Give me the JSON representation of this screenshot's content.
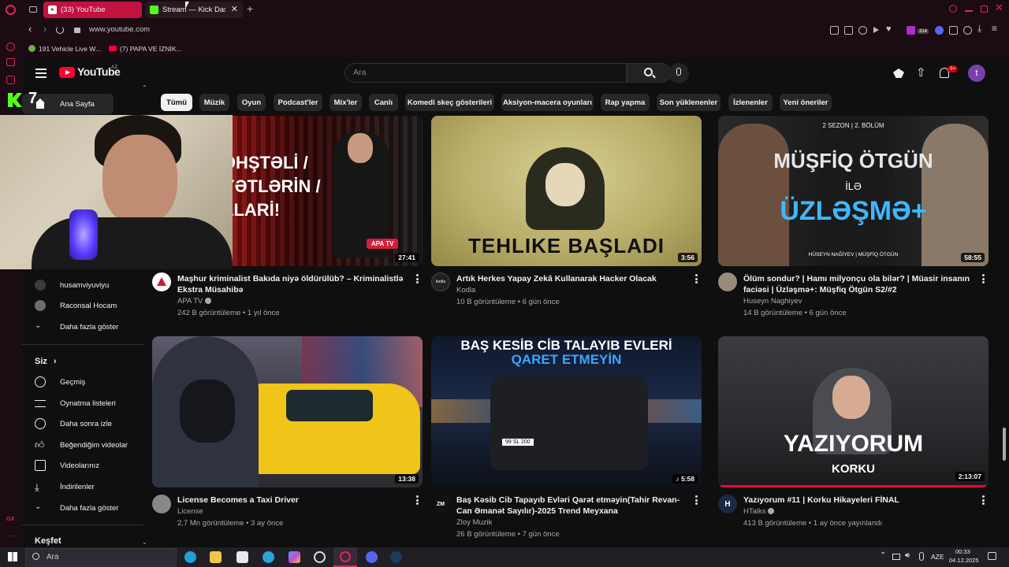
{
  "browser": {
    "tabs": [
      {
        "title": "(33) YouTube"
      },
      {
        "title": "Stream — Kick Dashbo"
      }
    ],
    "url": "www.youtube.com",
    "bookmarks": [
      "191 Vehicle Live W...",
      "(7) PAPA VE İZNİK..."
    ],
    "ext_badge": "314"
  },
  "youtube": {
    "logo_text": "YouTube",
    "region": "AZ",
    "search_placeholder": "Ara",
    "notification_badge": "9+",
    "account_initial": "t",
    "chips": [
      "Tümü",
      "Müzik",
      "Oyun",
      "Podcast'ler",
      "Mix'ler",
      "Canlı",
      "Komedi skeç gösterileri",
      "Aksiyon-macera oyunları",
      "Rap yapma",
      "Son yüklenenler",
      "İzlenenler",
      "Yeni öneriler"
    ],
    "sidebar": {
      "home": "Ana Sayfa",
      "subscriptions": [
        "husamviyuviyu",
        "Raconsal Hocam"
      ],
      "show_more": "Daha fazla göster",
      "you_header": "Siz",
      "you_items": [
        "Geçmiş",
        "Oynatma listeleri",
        "Daha sonra izle",
        "Beğendiğim videolar",
        "Videolarınız",
        "İndirilenler"
      ],
      "show_more_2": "Daha fazla göster",
      "explore": "Keşfet"
    },
    "videos": [
      {
        "thumb_text": "ƏHŞTƏLİ / YƏTLƏRİN / LLARİ!",
        "badge": "APA TV",
        "duration": "27:41",
        "title": "Maşhur kriminalist Bakıda niyə öldürülüb? – Kriminalistlə Ekstra Müsahibə",
        "channel": "APA TV",
        "meta": "242 B görüntüleme • 1 yıl önce"
      },
      {
        "thumb_text": "TEHLIKE BAŞLADI",
        "duration": "3:56",
        "title": "Artık Herkes Yapay Zekâ Kullanarak Hacker Olacak",
        "channel": "Kodla",
        "meta": "10 B görüntüleme • 6 gün önce"
      },
      {
        "thumb_top": "2 SEZON | 2. BÖLÜM",
        "thumb_line1": "MÜŞFİQ ÖTGÜN",
        "thumb_line2": "İLƏ",
        "thumb_line3": "ÜZLƏŞMƏ+",
        "thumb_names": "HÜSEYN NAĞİYEV  |  MÜŞFİQ ÖTGÜN",
        "duration": "58:55",
        "title": "Ölüm sondur? | Hamı milyonçu ola bilər? | Müasir insanın faciəsi | Üzləşmə+: Müşfiq Ötgün S2/#2",
        "channel": "Huseyn Naghiyev",
        "meta": "14 B görüntüleme • 6 gün önce"
      },
      {
        "duration": "13:38",
        "title": "License Becomes a Taxi Driver",
        "channel": "License",
        "meta": "2,7 Mn görüntüleme • 3 ay önce"
      },
      {
        "thumb_line1": "BAŞ KESİB CİB TALAYIB EVLERİ",
        "thumb_line2": "QARET ETMEYİN",
        "plate": "99 SL 200",
        "duration": "5:58",
        "title": "Baş Kəsib Cib Tapayıb Evləri Qarət etməyin(Tahir Revan-Can Əmanət Sayılır)-2025 Trend Meyxana",
        "channel": "Zloy Muzik",
        "meta": "26 B görüntüleme • 7 gün önce"
      },
      {
        "thumb_line1": "YAZIYORUM",
        "thumb_line2": "KORKU",
        "duration": "2:13:07",
        "title": "Yazıyorum #11 | Korku Hikayeleri FİNAL",
        "channel": "HTalks",
        "meta": "413 B görüntüleme • 1 ay önce yayınlandı"
      }
    ]
  },
  "overlay": {
    "kick_count": "7"
  },
  "taskbar": {
    "search": "Ara",
    "lang": "AZE",
    "time": "00:33",
    "date": "04.12.2025"
  },
  "colors": {
    "youtube_red": "#ff0033",
    "opera_red": "#e0245e",
    "kick_green": "#53fc18",
    "account_purple": "#7b3fb0"
  }
}
